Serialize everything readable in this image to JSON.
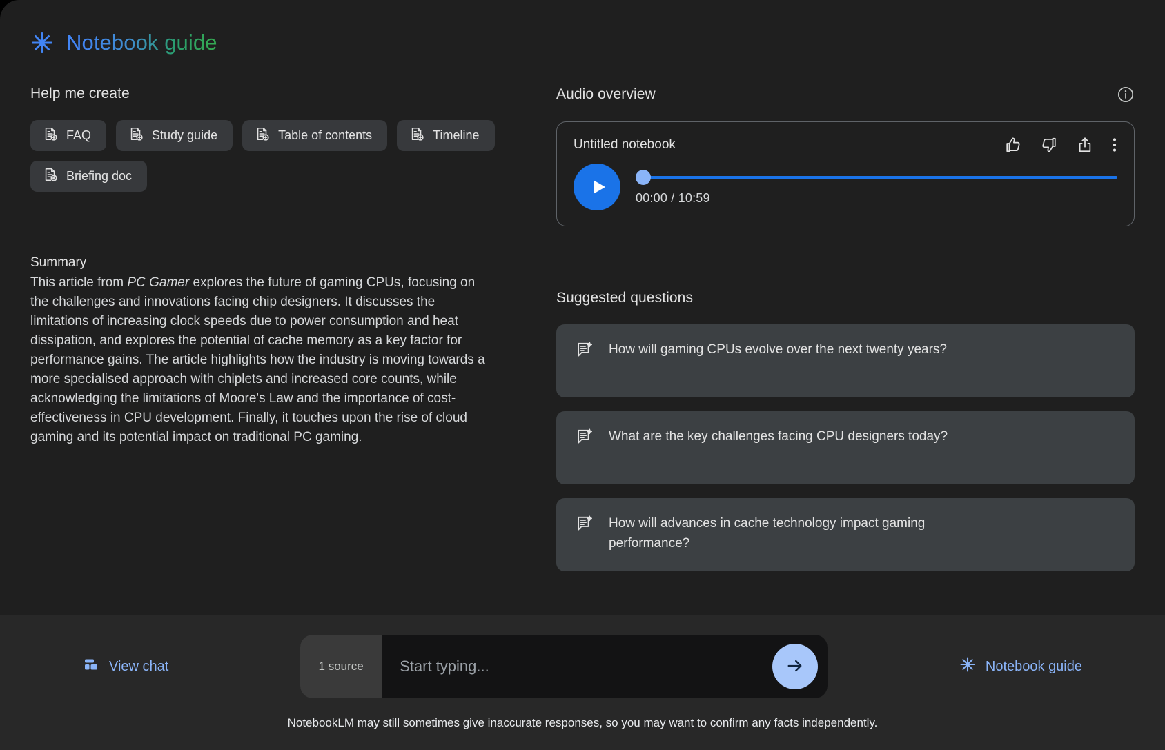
{
  "header": {
    "title": "Notebook guide",
    "icon": "asterisk-spark-icon",
    "gradient_from": "#4285f4",
    "gradient_to": "#34a853"
  },
  "help_me_create": {
    "title": "Help me create",
    "chips": [
      {
        "label": "FAQ",
        "icon": "document-add-icon"
      },
      {
        "label": "Study guide",
        "icon": "document-add-icon"
      },
      {
        "label": "Table of contents",
        "icon": "document-add-icon"
      },
      {
        "label": "Timeline",
        "icon": "document-add-icon"
      },
      {
        "label": "Briefing doc",
        "icon": "document-add-icon"
      }
    ]
  },
  "summary": {
    "title": "Summary",
    "text_before_italic": "This article from ",
    "italic_source": "PC Gamer",
    "text_after_italic": " explores the future of gaming CPUs, focusing on the challenges and innovations facing chip designers. It discusses the limitations of increasing clock speeds due to power consumption and heat dissipation, and explores the potential of cache memory as a key factor for performance gains. The article highlights how the industry is moving towards a more specialised approach with chiplets and increased core counts, while acknowledging the limitations of Moore's Law and the importance of cost-effectiveness in CPU development. Finally, it touches upon the rise of cloud gaming and its potential impact on traditional PC gaming."
  },
  "audio_overview": {
    "title": "Audio overview",
    "info_icon": "info-circle-icon",
    "notebook_name": "Untitled notebook",
    "actions": [
      {
        "name": "thumb-up-icon",
        "label": "Like"
      },
      {
        "name": "thumb-down-icon",
        "label": "Dislike"
      },
      {
        "name": "share-icon",
        "label": "Share"
      },
      {
        "name": "more-vertical-icon",
        "label": "More options"
      }
    ],
    "play_label": "Play",
    "current_time": "00:00",
    "duration": "10:59",
    "time_display": "00:00 / 10:59",
    "progress_percent": 0,
    "accent_color": "#1a73e8",
    "thumb_color": "#8ab4f8"
  },
  "suggested_questions": {
    "title": "Suggested questions",
    "items": [
      {
        "text": "How will gaming CPUs evolve over the next twenty years?",
        "icon": "chat-sparkle-icon"
      },
      {
        "text": "What are the key challenges facing CPU designers today?",
        "icon": "chat-sparkle-icon"
      },
      {
        "text": "How will advances in cache technology impact gaming performance?",
        "icon": "chat-sparkle-icon"
      }
    ]
  },
  "bottom_bar": {
    "view_chat_label": "View chat",
    "view_chat_icon": "chat-bubble-icon",
    "source_count_label": "1 source",
    "input_placeholder": "Start typing...",
    "input_value": "",
    "send_icon": "arrow-right-icon",
    "notebook_guide_label": "Notebook guide",
    "notebook_guide_icon": "asterisk-spark-icon",
    "disclaimer": "NotebookLM may still sometimes give inaccurate responses, so you may want to confirm any facts independently."
  }
}
